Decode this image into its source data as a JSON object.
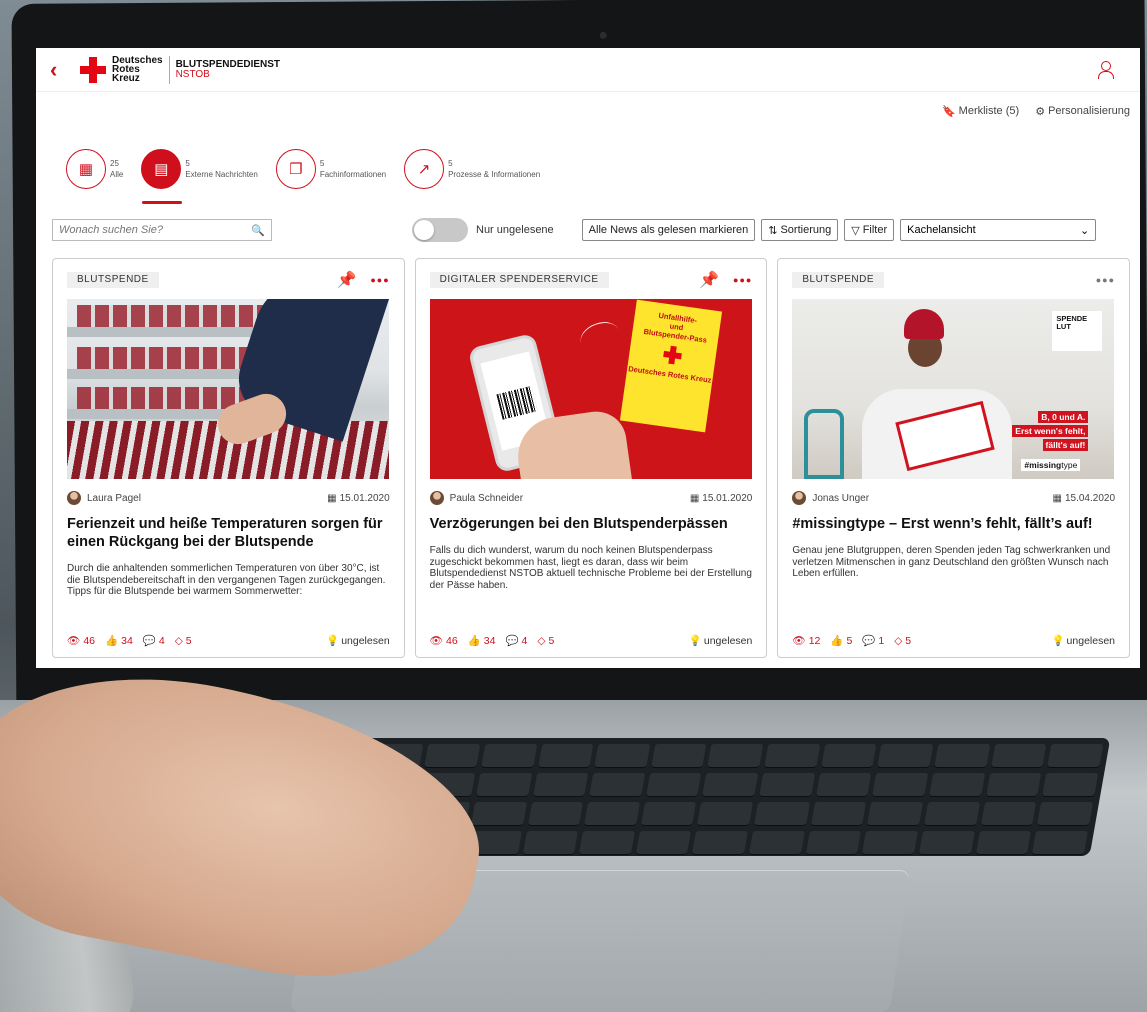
{
  "header": {
    "back_icon": "chevron-left-icon",
    "org_lines": [
      "Deutsches",
      "Rotes",
      "Kreuz"
    ],
    "service_name": "BLUTSPENDEDIENST",
    "service_sub": "NSTOB",
    "user_icon": "user-icon"
  },
  "subbar": {
    "watchlist_label": "Merkliste (5)",
    "personalization_label": "Personalisierung"
  },
  "categories": [
    {
      "count": "25",
      "label": "Alle",
      "icon": "grid-icon",
      "active": false
    },
    {
      "count": "5",
      "label": "Externe Nachrichten",
      "icon": "newspaper-icon",
      "active": true
    },
    {
      "count": "5",
      "label": "Fachinformationen",
      "icon": "book-icon",
      "active": false
    },
    {
      "count": "5",
      "label": "Prozesse & Informationen",
      "icon": "process-icon",
      "active": false
    }
  ],
  "toolbar": {
    "search_placeholder": "Wonach suchen Sie?",
    "toggle_label": "Nur ungelesene",
    "mark_all_label": "Alle News als gelesen markieren",
    "sort_label": "Sortierung",
    "filter_label": "Filter",
    "view_label": "Kachelansicht"
  },
  "cards": [
    {
      "category": "BLUTSPENDE",
      "author": "Laura Pagel",
      "date": "15.01.2020",
      "title": "Ferienzeit und heiße Temperaturen sorgen für einen Rückgang bei der Blutspende",
      "body": "Durch die anhaltenden sommerlichen Temperaturen von über 30°C, ist die Blutspendebereitschaft in den vergangenen Tagen zurückgegangen. Tipps für die Blutspende bei warmem Sommerwetter:",
      "views": "46",
      "likes": "34",
      "comments": "4",
      "shares": "5",
      "status": "ungelesen"
    },
    {
      "category": "DIGITALER SPENDERSERVICE",
      "author": "Paula Schneider",
      "date": "15.01.2020",
      "title": "Verzögerungen bei den Blutspenderpässen",
      "body": "Falls du dich wunderst, warum du noch keinen Blutspenderpass zugeschickt bekommen hast, liegt es daran, dass wir beim Blutspendedienst NSTOB aktuell technische Probleme bei der Erstellung der Pässe haben.",
      "views": "46",
      "likes": "34",
      "comments": "4",
      "shares": "5",
      "status": "ungelesen",
      "image_text": [
        "Unfallhilfe-",
        "und",
        "Blutspender-Pass",
        "Deutsches Rotes Kreuz"
      ]
    },
    {
      "category": "BLUTSPENDE",
      "author": "Jonas Unger",
      "date": "15.04.2020",
      "title": "#missingtype – Erst wenn’s fehlt, fällt’s auf!",
      "body": "Genau jene Blutgruppen, deren Spenden jeden Tag schwerkranken und verletzen Mitmenschen in ganz Deutschland den größten Wunsch nach Leben erfüllen.",
      "views": "12",
      "likes": "5",
      "comments": "1",
      "shares": "5",
      "status": "ungelesen",
      "image_text": [
        "B, 0 und A.",
        "Erst wenn's fehlt,",
        "fällt's auf!",
        "#missing",
        "type",
        "SPENDE",
        "LUT"
      ]
    }
  ],
  "colors": {
    "accent": "#d00f1c",
    "dark_text": "#111111",
    "badge_bg": "#efefef"
  }
}
